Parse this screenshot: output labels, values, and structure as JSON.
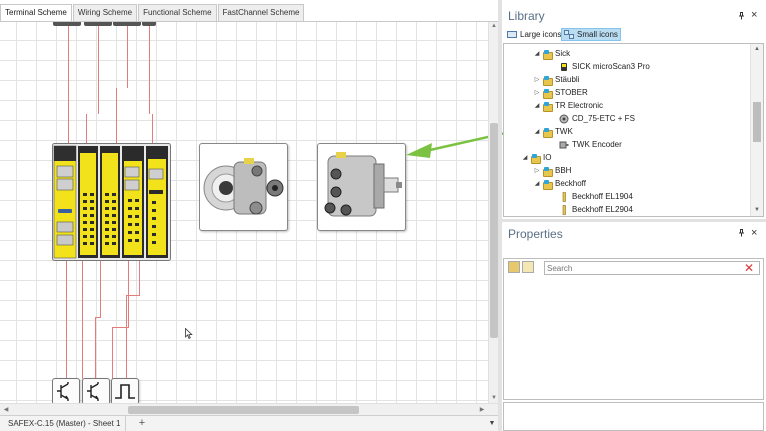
{
  "tabs": [
    {
      "label": "Terminal Scheme",
      "active": true
    },
    {
      "label": "Wiring Scheme",
      "active": false
    },
    {
      "label": "Functional Scheme",
      "active": false
    },
    {
      "label": "FastChannel Scheme",
      "active": false
    }
  ],
  "sheet": {
    "tab_label": "SAFEX-C.15 (Master) - Sheet 1",
    "add_label": "+",
    "menu_icon": "chevron-down-icon"
  },
  "library": {
    "title": "Library",
    "pin_icon": "pin-icon",
    "close_label": "×",
    "views": [
      {
        "label": "Large icons",
        "selected": false
      },
      {
        "label": "Small icons",
        "selected": true
      }
    ],
    "tree": [
      {
        "label": "Sick",
        "expanded": true,
        "kind": "folder"
      },
      {
        "label": "SICK microScan3 Pro",
        "kind": "device"
      },
      {
        "label": "Stäubli",
        "expanded": false,
        "kind": "folder"
      },
      {
        "label": "STOBER",
        "expanded": false,
        "kind": "folder"
      },
      {
        "label": "TR Electronic",
        "expanded": true,
        "kind": "folder"
      },
      {
        "label": "CD_75-ETC + FS",
        "kind": "device"
      },
      {
        "label": "TWK",
        "expanded": true,
        "kind": "folder"
      },
      {
        "label": "TWK Encoder",
        "kind": "device"
      },
      {
        "label": "IO",
        "expanded": true,
        "kind": "folder"
      },
      {
        "label": "BBH",
        "expanded": false,
        "kind": "folder"
      },
      {
        "label": "Beckhoff",
        "expanded": true,
        "kind": "folder"
      },
      {
        "label": "Beckhoff EL1904",
        "kind": "device"
      },
      {
        "label": "Beckhoff EL2904",
        "kind": "device"
      }
    ]
  },
  "properties": {
    "title": "Properties",
    "pin_icon": "pin-icon",
    "close_label": "×",
    "search_placeholder": "Search",
    "search_value": ""
  },
  "colors": {
    "accent": "#5a6f86",
    "wire": "#e57c7c",
    "arrow": "#7cc242",
    "module_yellow": "#f2e21c",
    "selection": "#b9dcf3"
  }
}
